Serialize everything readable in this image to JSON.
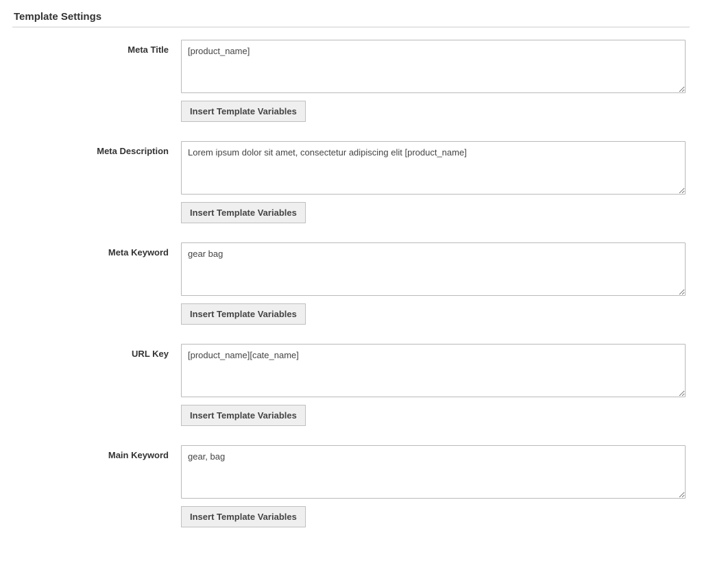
{
  "section": {
    "title": "Template Settings"
  },
  "fields": {
    "meta_title": {
      "label": "Meta Title",
      "value": "[product_name]",
      "button": "Insert Template Variables"
    },
    "meta_description": {
      "label": "Meta Description",
      "value": "Lorem ipsum dolor sit amet, consectetur adipiscing elit [product_name]",
      "button": "Insert Template Variables"
    },
    "meta_keyword": {
      "label": "Meta Keyword",
      "value": "gear bag",
      "button": "Insert Template Variables"
    },
    "url_key": {
      "label": "URL Key",
      "value": "[product_name][cate_name]",
      "button": "Insert Template Variables"
    },
    "main_keyword": {
      "label": "Main Keyword",
      "value": "gear, bag",
      "button": "Insert Template Variables"
    }
  }
}
